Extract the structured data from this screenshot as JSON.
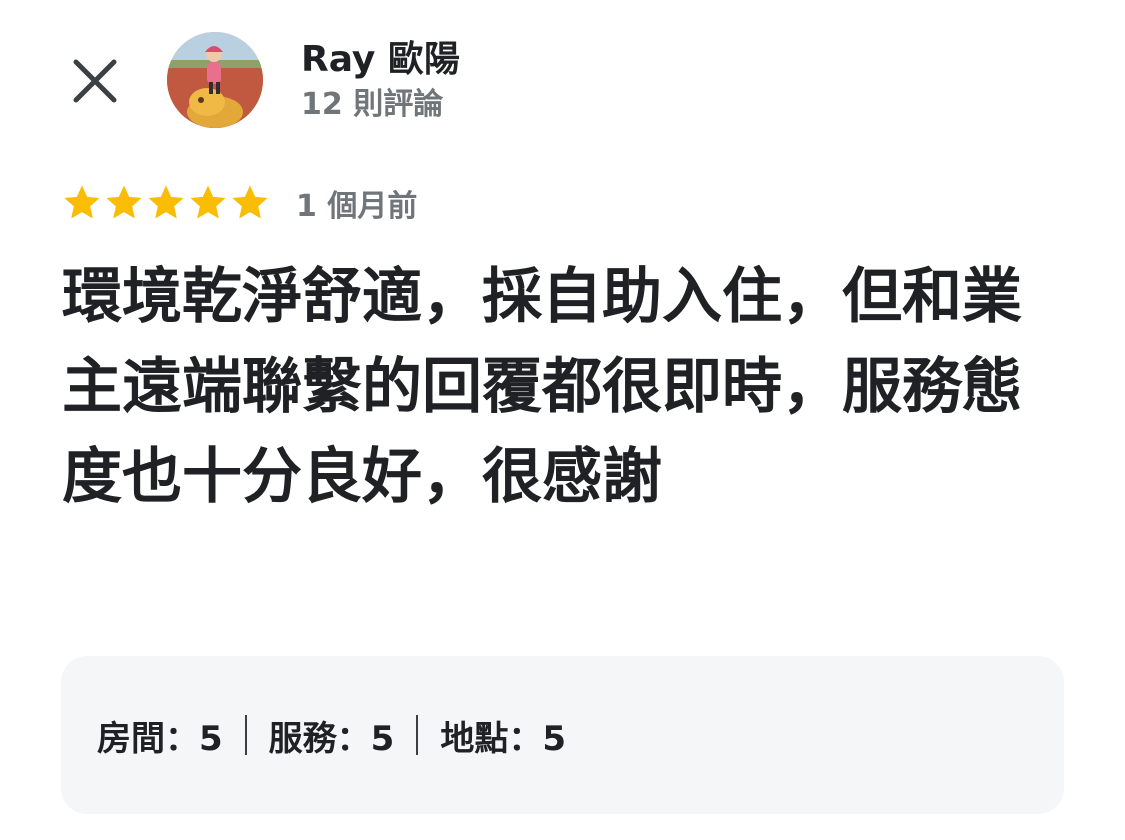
{
  "reviewer": {
    "name": "Ray 歐陽",
    "review_count": "12 則評論"
  },
  "rating": {
    "stars": 5,
    "max_stars": 5,
    "star_color": "#fbbc04",
    "time_ago": "1 個月前"
  },
  "review": {
    "text": "環境乾淨舒適，採自助入住，但和業主遠端聯繫的回覆都很即時，服務態度也十分良好，很感謝"
  },
  "subratings": [
    {
      "text": "房間：5"
    },
    {
      "text": "服務：5"
    },
    {
      "text": "地點：5"
    }
  ],
  "icons": {
    "close": "close-icon",
    "star": "star-icon"
  }
}
